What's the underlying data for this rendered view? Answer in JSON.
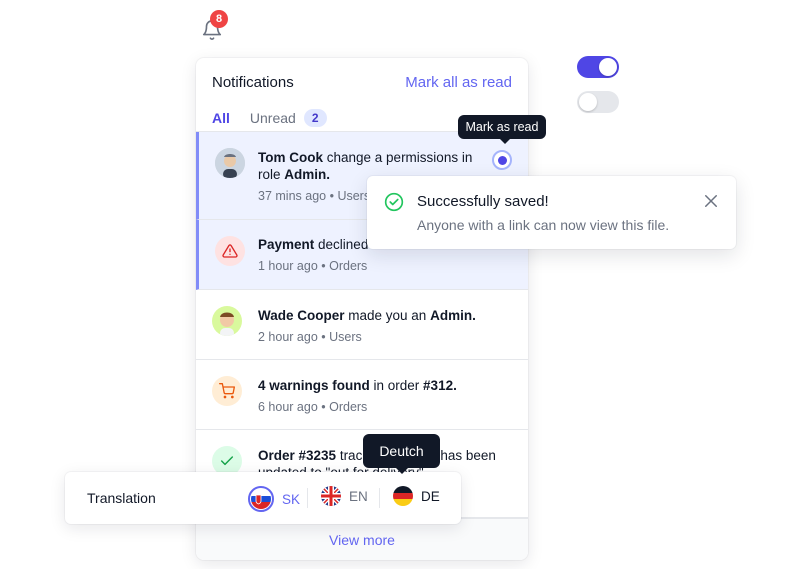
{
  "bell": {
    "badge_count": "8"
  },
  "panel": {
    "title": "Notifications",
    "mark_all": "Mark all as read",
    "tabs": [
      {
        "label": "All",
        "active": true
      },
      {
        "label": "Unread",
        "count": "2"
      }
    ],
    "items": [
      {
        "actor": "Tom Cook",
        "text": " change a permissions in role ",
        "object": "Admin.",
        "time": "37 mins ago",
        "category": "Users",
        "unread": true,
        "icon": "avatar-tom"
      },
      {
        "actor": "Payment",
        "text": " declined",
        "object": "",
        "time": "1 hour ago",
        "category": "Orders",
        "unread": true,
        "icon": "warning-icon"
      },
      {
        "actor": "Wade Cooper",
        "text": " made you an ",
        "object": "Admin.",
        "time": "2 hour ago",
        "category": "Users",
        "unread": false,
        "icon": "avatar-wade"
      },
      {
        "actor": "4 warnings found",
        "text": " in order ",
        "object": "#312.",
        "time": "6 hour ago",
        "category": "Orders",
        "unread": false,
        "icon": "cart-icon"
      },
      {
        "actor": "Order #3235",
        "text": " tracking number has been updated to \"out for delivery\"",
        "object": "",
        "time": "",
        "category": "",
        "unread": false,
        "icon": "check-icon"
      }
    ],
    "view_more": "View more"
  },
  "tooltips": {
    "mark_as_read": "Mark as read",
    "deutch": "Deutch"
  },
  "toast": {
    "title": "Successfully saved!",
    "body": "Anyone with a link can now view this file."
  },
  "translation": {
    "label": "Translation",
    "languages": [
      {
        "code": "SK",
        "selected": true
      },
      {
        "code": "EN",
        "selected": false
      },
      {
        "code": "DE",
        "selected": false
      }
    ]
  },
  "toggles": {
    "first_on": true,
    "second_on": false
  },
  "colors": {
    "accent": "#4f46e5",
    "success": "#22c55e",
    "danger": "#ef4444",
    "warning": "#f97316"
  }
}
